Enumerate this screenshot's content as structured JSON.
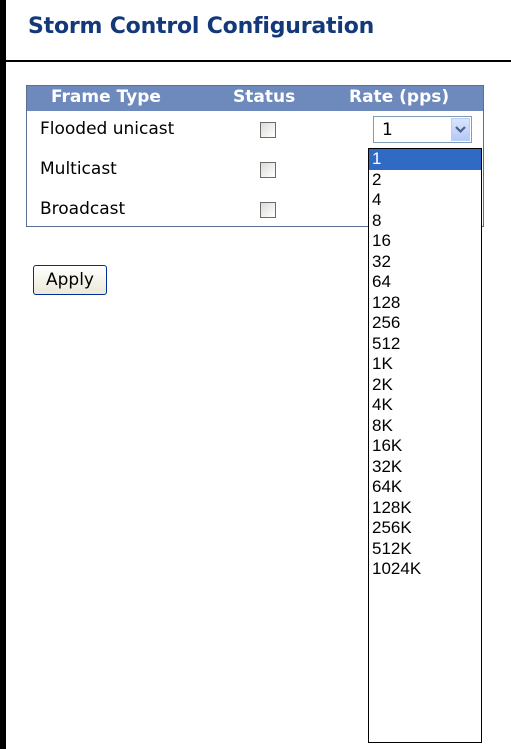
{
  "page": {
    "title": "Storm Control Configuration"
  },
  "table": {
    "headers": {
      "frame_type": "Frame Type",
      "status": "Status",
      "rate": "Rate (pps)"
    },
    "rows": [
      {
        "frame_type": "Flooded unicast",
        "status_checked": false
      },
      {
        "frame_type": "Multicast",
        "status_checked": false
      },
      {
        "frame_type": "Broadcast",
        "status_checked": false
      }
    ]
  },
  "rate_select": {
    "selected": "1"
  },
  "dropdown": {
    "options": [
      "1",
      "2",
      "4",
      "8",
      "16",
      "32",
      "64",
      "128",
      "256",
      "512",
      "1K",
      "2K",
      "4K",
      "8K",
      "16K",
      "32K",
      "64K",
      "128K",
      "256K",
      "512K",
      "1024K"
    ],
    "highlighted": "1"
  },
  "actions": {
    "apply_label": "Apply"
  },
  "colors": {
    "title": "#13397b",
    "header_bg": "#6e8abd",
    "highlight": "#316ac5"
  }
}
